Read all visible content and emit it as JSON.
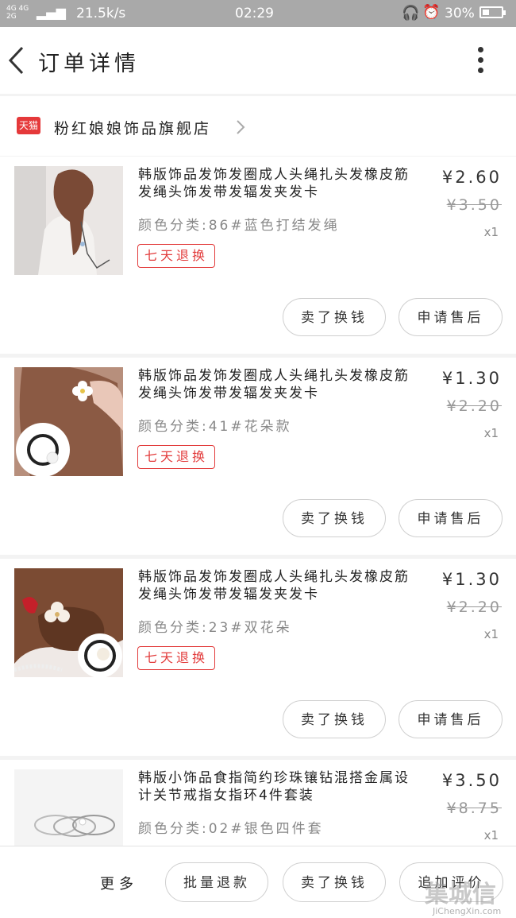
{
  "status_bar": {
    "network": "4G 4G 2G",
    "speed": "21.5k/s",
    "time": "02:29",
    "battery": "30%"
  },
  "nav": {
    "title": "订单详情"
  },
  "shop": {
    "name": "粉红娘娘饰品旗舰店",
    "badge": "天猫"
  },
  "items": [
    {
      "title": "韩版饰品发饰发圈成人头绳扎头发橡皮筋发绳头饰发带发辐发夹发卡",
      "sku": "颜色分类:86#蓝色打结发绳",
      "price": "¥2.60",
      "orig_price": "¥3.50",
      "qty": "x1",
      "tag": "七天退换",
      "btn_exchange": "卖了换钱",
      "btn_aftersale": "申请售后"
    },
    {
      "title": "韩版饰品发饰发圈成人头绳扎头发橡皮筋发绳头饰发带发辐发夹发卡",
      "sku": "颜色分类:41#花朵款",
      "price": "¥1.30",
      "orig_price": "¥2.20",
      "qty": "x1",
      "tag": "七天退换",
      "btn_exchange": "卖了换钱",
      "btn_aftersale": "申请售后"
    },
    {
      "title": "韩版饰品发饰发圈成人头绳扎头发橡皮筋发绳头饰发带发辐发夹发卡",
      "sku": "颜色分类:23#双花朵",
      "price": "¥1.30",
      "orig_price": "¥2.20",
      "qty": "x1",
      "tag": "七天退换",
      "btn_exchange": "卖了换钱",
      "btn_aftersale": "申请售后"
    },
    {
      "title": "韩版小饰品食指简约珍珠镶钻混搭金属设计关节戒指女指环4件套装",
      "sku": "颜色分类:02#银色四件套",
      "price": "¥3.50",
      "orig_price": "¥8.75",
      "qty": "x1"
    }
  ],
  "bottom_bar": {
    "more": "更多",
    "refund": "批量退款",
    "exchange": "卖了换钱",
    "review": "追加评价"
  },
  "watermark": {
    "big": "集城信",
    "small": "JiChengXin.com"
  }
}
